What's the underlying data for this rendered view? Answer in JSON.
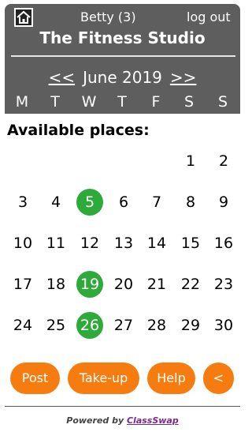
{
  "header": {
    "home_icon": "home-icon",
    "user": "Betty (3)",
    "logout": "log out",
    "title": "The Fitness Studio",
    "prev": "<<",
    "month": "June 2019",
    "next": ">>"
  },
  "weekdays": [
    "M",
    "T",
    "W",
    "T",
    "F",
    "S",
    "S"
  ],
  "available_label": "Available places:",
  "calendar": {
    "weeks": [
      [
        null,
        null,
        null,
        null,
        null,
        "1",
        "2"
      ],
      [
        "3",
        "4",
        "5",
        "6",
        "7",
        "8",
        "9"
      ],
      [
        "10",
        "11",
        "12",
        "13",
        "14",
        "15",
        "16"
      ],
      [
        "17",
        "18",
        "19",
        "20",
        "21",
        "22",
        "23"
      ],
      [
        "24",
        "25",
        "26",
        "27",
        "28",
        "29",
        "30"
      ]
    ],
    "available_days": [
      "5",
      "19",
      "26"
    ],
    "available_color": "#2eaa3a"
  },
  "buttons": {
    "post": "Post",
    "takeup": "Take-up",
    "help": "Help",
    "back": "<"
  },
  "accent_color": "#f77c0f",
  "footer": {
    "powered_by": "Powered by",
    "brand": "ClassSwap"
  }
}
